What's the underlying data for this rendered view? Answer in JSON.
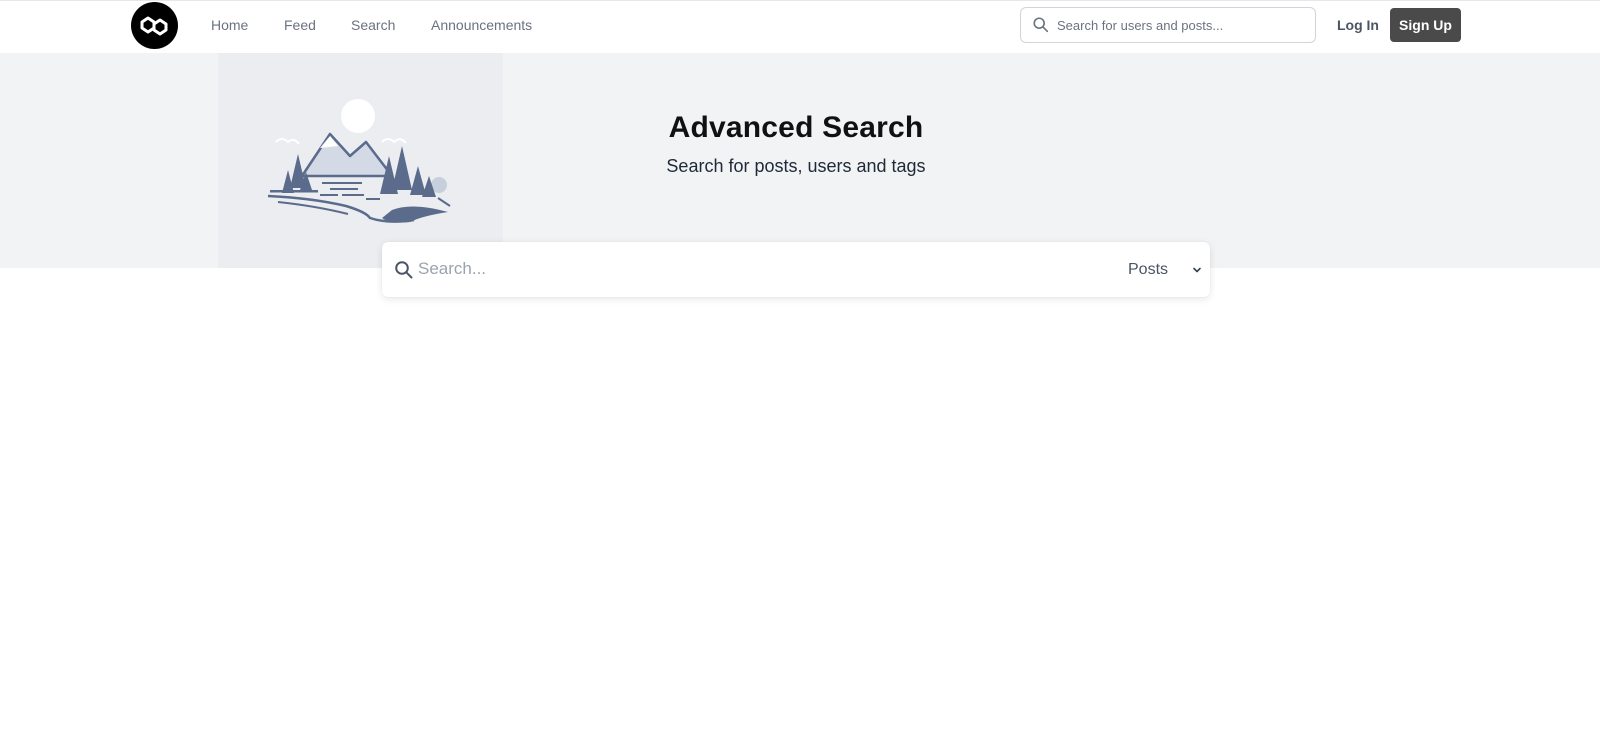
{
  "brand": {
    "logo_icon": "chain-link-icon"
  },
  "nav": {
    "items": [
      {
        "label": "Home"
      },
      {
        "label": "Feed"
      },
      {
        "label": "Search"
      },
      {
        "label": "Announcements"
      }
    ]
  },
  "header_search": {
    "placeholder": "Search for users and posts...",
    "icon": "search-icon"
  },
  "auth": {
    "login_label": "Log In",
    "signup_label": "Sign Up"
  },
  "hero": {
    "title": "Advanced Search",
    "subtitle": "Search for posts, users and tags",
    "illustration": "mountain-landscape-illustration"
  },
  "search": {
    "placeholder": "Search...",
    "icon": "search-icon",
    "type_selected": "Posts"
  },
  "colors": {
    "hero_bg": "#f2f3f5",
    "illustration_bg": "#ebedf1",
    "signup_bg": "#4a4a4a",
    "illustration_ink": "#5b6b8c"
  }
}
